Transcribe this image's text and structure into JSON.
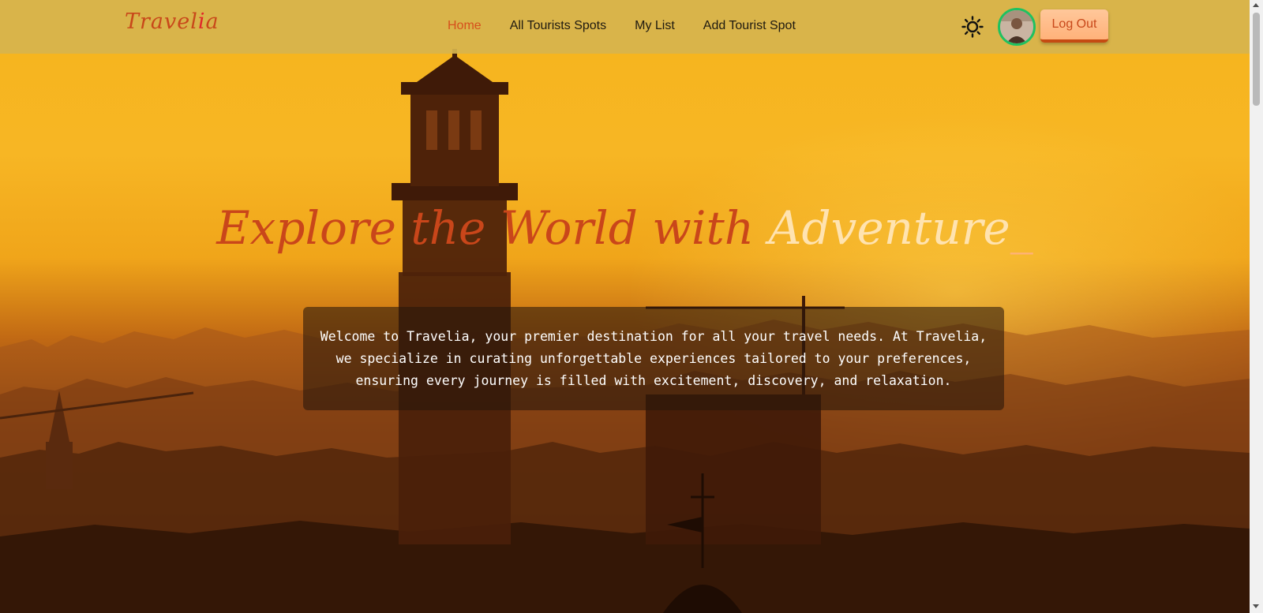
{
  "brand": {
    "name_part1": "Travel",
    "name_accent": "i",
    "name_part2": "a"
  },
  "nav": {
    "items": [
      {
        "label": "Home",
        "active": true
      },
      {
        "label": "All Tourists Spots",
        "active": false
      },
      {
        "label": "My List",
        "active": false
      },
      {
        "label": "Add Tourist Spot",
        "active": false
      }
    ],
    "theme_icon": "sun-icon",
    "logout_label": "Log Out"
  },
  "hero": {
    "headline_main": "Explore the World with ",
    "headline_typed": "Adventure",
    "headline_cursor": "_",
    "intro_lines": [
      "Welcome to Travelia, your premier destination for all your travel needs. At Travelia,",
      "we specialize in curating unforgettable experiences tailored to your preferences,",
      "ensuring every journey is filled with excitement, discovery, and relaxation."
    ]
  },
  "colors": {
    "brand": "#c8481a",
    "active_nav": "#d6501c",
    "avatar_ring": "#1fc160",
    "button_bg": "#ffb27a"
  }
}
